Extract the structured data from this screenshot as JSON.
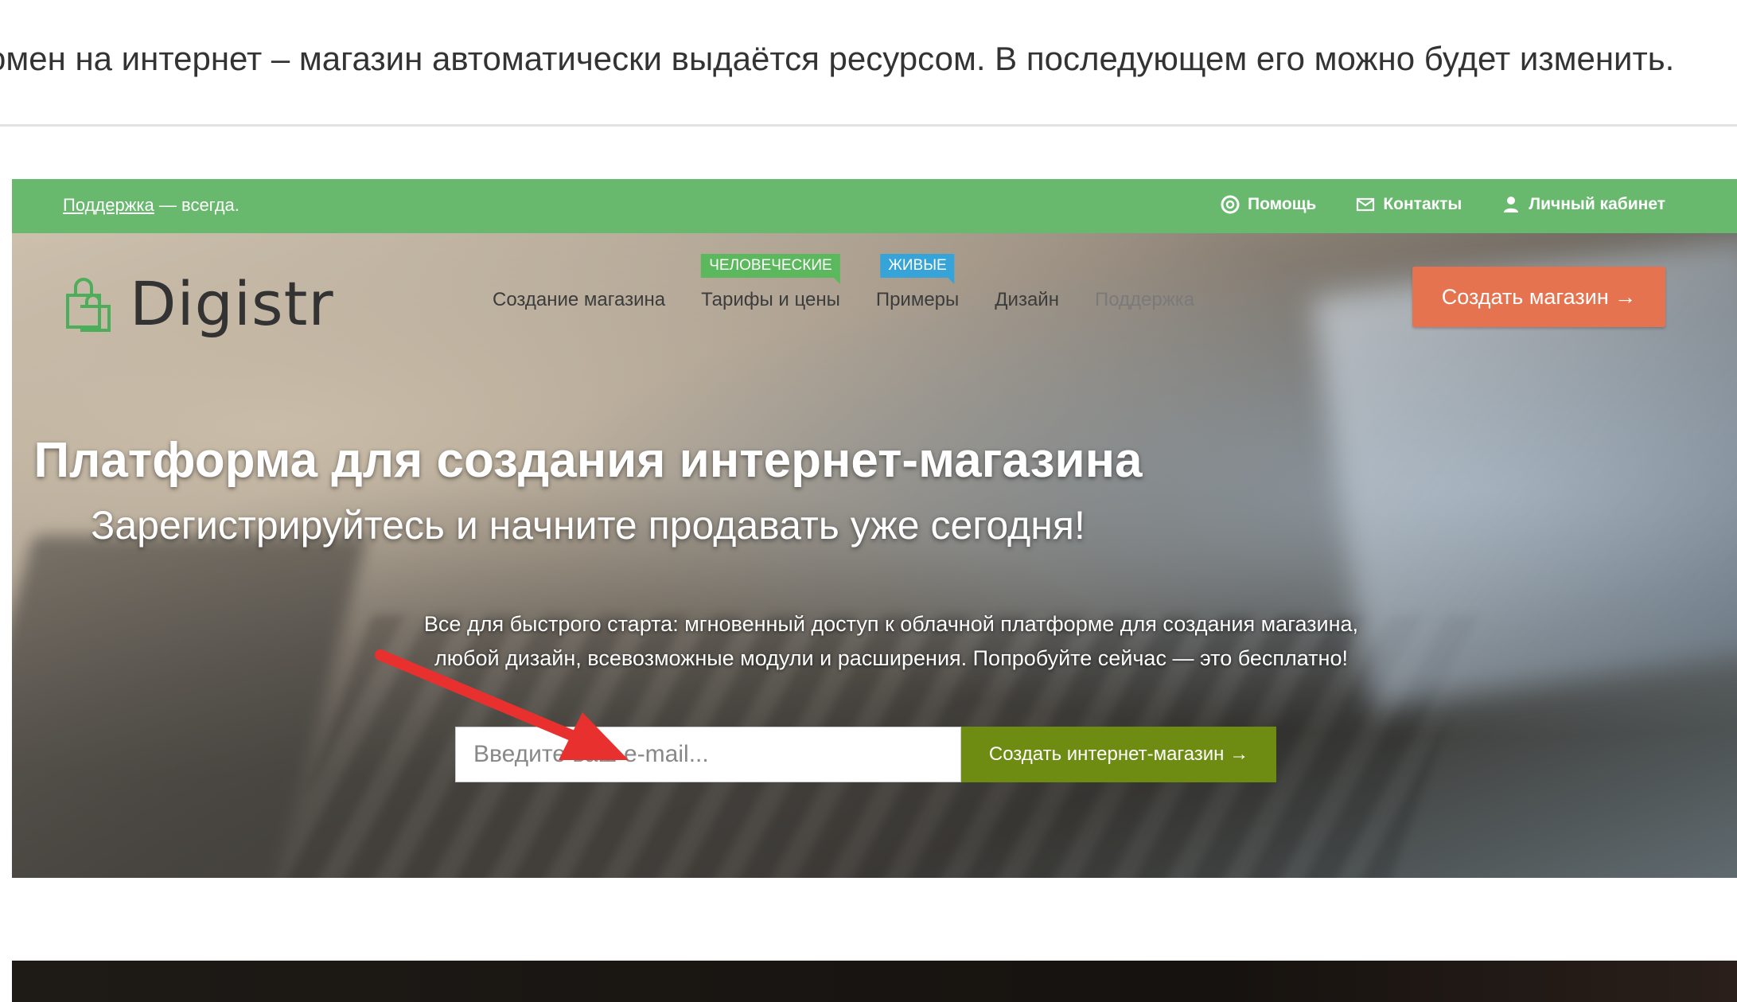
{
  "article": {
    "text": "омен на интернет – магазин автоматически выдаётся ресурсом. В последующем его можно будет изменить."
  },
  "topbar": {
    "support_link": "Поддержка",
    "support_suffix": " — всегда.",
    "links": [
      {
        "label": "Помощь",
        "icon": "lifebuoy-icon"
      },
      {
        "label": "Контакты",
        "icon": "envelope-icon"
      },
      {
        "label": "Личный кабинет",
        "icon": "user-icon"
      }
    ]
  },
  "header": {
    "logo_text": "Digistr",
    "nav": [
      {
        "label": "Создание магазина"
      },
      {
        "label": "Тарифы и цены",
        "tag": "ЧЕЛОВЕЧЕСКИЕ"
      },
      {
        "label": "Примеры",
        "tag": "ЖИВЫЕ"
      },
      {
        "label": "Дизайн"
      },
      {
        "label": "Поддержка"
      }
    ],
    "cta_label": "Создать магазин →"
  },
  "hero": {
    "title": "Платформа для создания интернет-магазина",
    "subtitle": "Зарегистрируйтесь и начните продавать уже сегодня!",
    "desc_line1": "Все для быстрого старта: мгновенный доступ к облачной платформе для создания магазина,",
    "desc_line2": "любой дизайн, всевозможные модули и расширения. Попробуйте сейчас — это бесплатно!",
    "email_placeholder": "Введите ваш e-mail...",
    "signup_label": "Создать интернет-магазин →"
  },
  "colors": {
    "topbar": "#68b96e",
    "cta_orange": "#e5734f",
    "signup_green": "#6e8c12",
    "tag_green": "#5cb85c",
    "tag_blue": "#36a3d9",
    "annotation_arrow": "#e8312f"
  }
}
